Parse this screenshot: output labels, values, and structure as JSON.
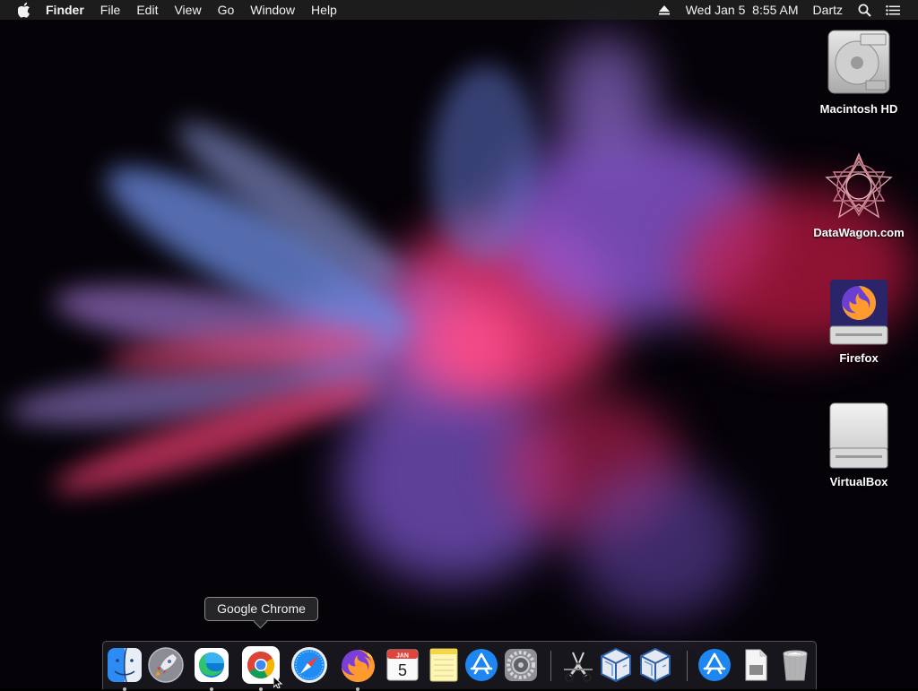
{
  "menubar": {
    "app_name": "Finder",
    "menus": [
      "File",
      "Edit",
      "View",
      "Go",
      "Window",
      "Help"
    ],
    "datetime": "Wed Jan 5  8:55 AM",
    "user": "Dartz",
    "icons": [
      "apple-icon",
      "eject-icon",
      "search-icon",
      "list-icon"
    ]
  },
  "desktop": {
    "icons": [
      {
        "label": "Macintosh HD",
        "icon": "hard-drive-icon"
      },
      {
        "label": "DataWagon.com",
        "icon": "star-pattern-icon"
      },
      {
        "label": "Firefox",
        "icon": "firefox-disk-icon"
      },
      {
        "label": "VirtualBox",
        "icon": "external-drive-icon"
      }
    ]
  },
  "tooltip": {
    "text": "Google Chrome"
  },
  "dock": {
    "items": [
      {
        "icon": "finder-icon",
        "running": true
      },
      {
        "icon": "launchpad-icon",
        "running": false
      },
      {
        "icon": "edge-icon",
        "running": true
      },
      {
        "icon": "chrome-icon",
        "running": true
      },
      {
        "icon": "safari-icon",
        "running": false
      },
      {
        "icon": "firefox-icon",
        "running": true
      },
      {
        "icon": "calendar-icon",
        "running": false,
        "month": "JAN",
        "day": "5"
      },
      {
        "icon": "notes-icon",
        "running": false
      },
      {
        "icon": "app-store-icon",
        "running": false
      },
      {
        "icon": "system-preferences-icon",
        "running": false
      },
      {
        "icon": "screenshot-tool-icon",
        "running": false
      },
      {
        "icon": "virtualbox-icon",
        "running": false
      },
      {
        "icon": "virtualbox-icon",
        "running": false
      },
      {
        "icon": "app-store-downloads-icon",
        "running": false
      },
      {
        "icon": "document-icon",
        "running": false
      },
      {
        "icon": "trash-icon",
        "running": false
      }
    ]
  },
  "colors": {
    "menubar_bg": "#1e1e20",
    "wallpaper_bg": "#050208"
  }
}
